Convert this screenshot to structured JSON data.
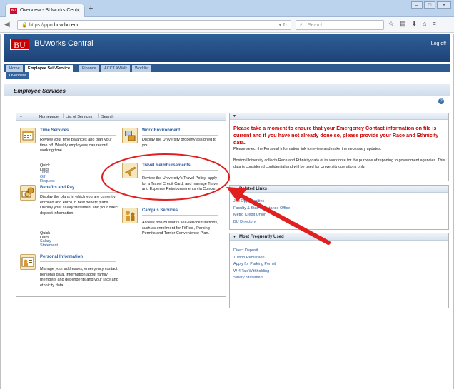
{
  "browser": {
    "tab_title": "Overview - BUworks Centr...",
    "favicon_text": "BU",
    "url_prefix": "https://ppo.",
    "url_domain": "buw.bu.edu",
    "search_placeholder": "Search"
  },
  "header": {
    "logo": "BU",
    "app_title": "BUworks Central",
    "logoff": "Log off"
  },
  "tabs": [
    {
      "label": "Home"
    },
    {
      "label": "Employee Self-Service"
    },
    {
      "label": "Finance"
    },
    {
      "label": "ACCT XWalk"
    },
    {
      "label": "Worklist"
    }
  ],
  "subtab": "Overview",
  "section_title": "Employee Services",
  "help_icon_text": "?",
  "left_panel": {
    "links": [
      "Homepage",
      "List of Services",
      "Search"
    ],
    "services": {
      "time": {
        "name": "Time Services",
        "desc": "Review your time balances and plan your time off. Weekly employees can record working time.",
        "quick_links_label": "Quick Links",
        "link": "Time Off Request"
      },
      "work_env": {
        "name": "Work Environment",
        "desc": "Display the University property assigned to you."
      },
      "travel": {
        "name": "Travel Reimbursements",
        "desc": "Review the University's Travel Policy, apply for a Travel Credit Card, and manage Travel and Expense Reimbursements via Concur."
      },
      "benefits": {
        "name": "Benefits and Pay",
        "desc": "Display the plans in which you are currently enrolled and enroll in new benefit plans.\nDisplay your salary statement and your direct deposit information.",
        "quick_links_label": "Quick Links",
        "link": "Salary Statement"
      },
      "campus": {
        "name": "Campus Services",
        "desc": "Access non-BUworks self-service functions, such as enrollment for FitRec , Parking Permits and Terrier Convenience Plan."
      },
      "personal": {
        "name": "Personal Information",
        "desc": "Manage your addresses, emergency contact, personal data, information about family members and dependents and your race and ethnicity data."
      }
    }
  },
  "right_panel": {
    "alert": "Please take a moment to ensure that your Emergency Contact information on file is current and if you have not already done so, please provide your Race and Ethnicity data.",
    "para1": "Please select the Personal Information link to review and make the necessary updates.",
    "para2": "Boston University collects Race and Ethnicity data of its workforce for the purpose of reporting to government agencies. This data is considered confidential and will be used for University operations only."
  },
  "related_links": {
    "title": "Related Links",
    "items": [
      "Job Opportunities",
      "Faculty & Staff Assistance Office",
      "Metro Credit Union",
      "BU Directory"
    ]
  },
  "most_used": {
    "title": "Most Frequently Used",
    "items": [
      "Direct Deposit",
      "Tuition Remission",
      "Apply for Parking Permit",
      "W-4 Tax Withholding",
      "Salary Statement"
    ]
  },
  "colors": {
    "annotation_red": "#e02020",
    "alert_red": "#cc0000",
    "link_blue": "#2a5d9c",
    "header_blue": "#1d4277"
  }
}
